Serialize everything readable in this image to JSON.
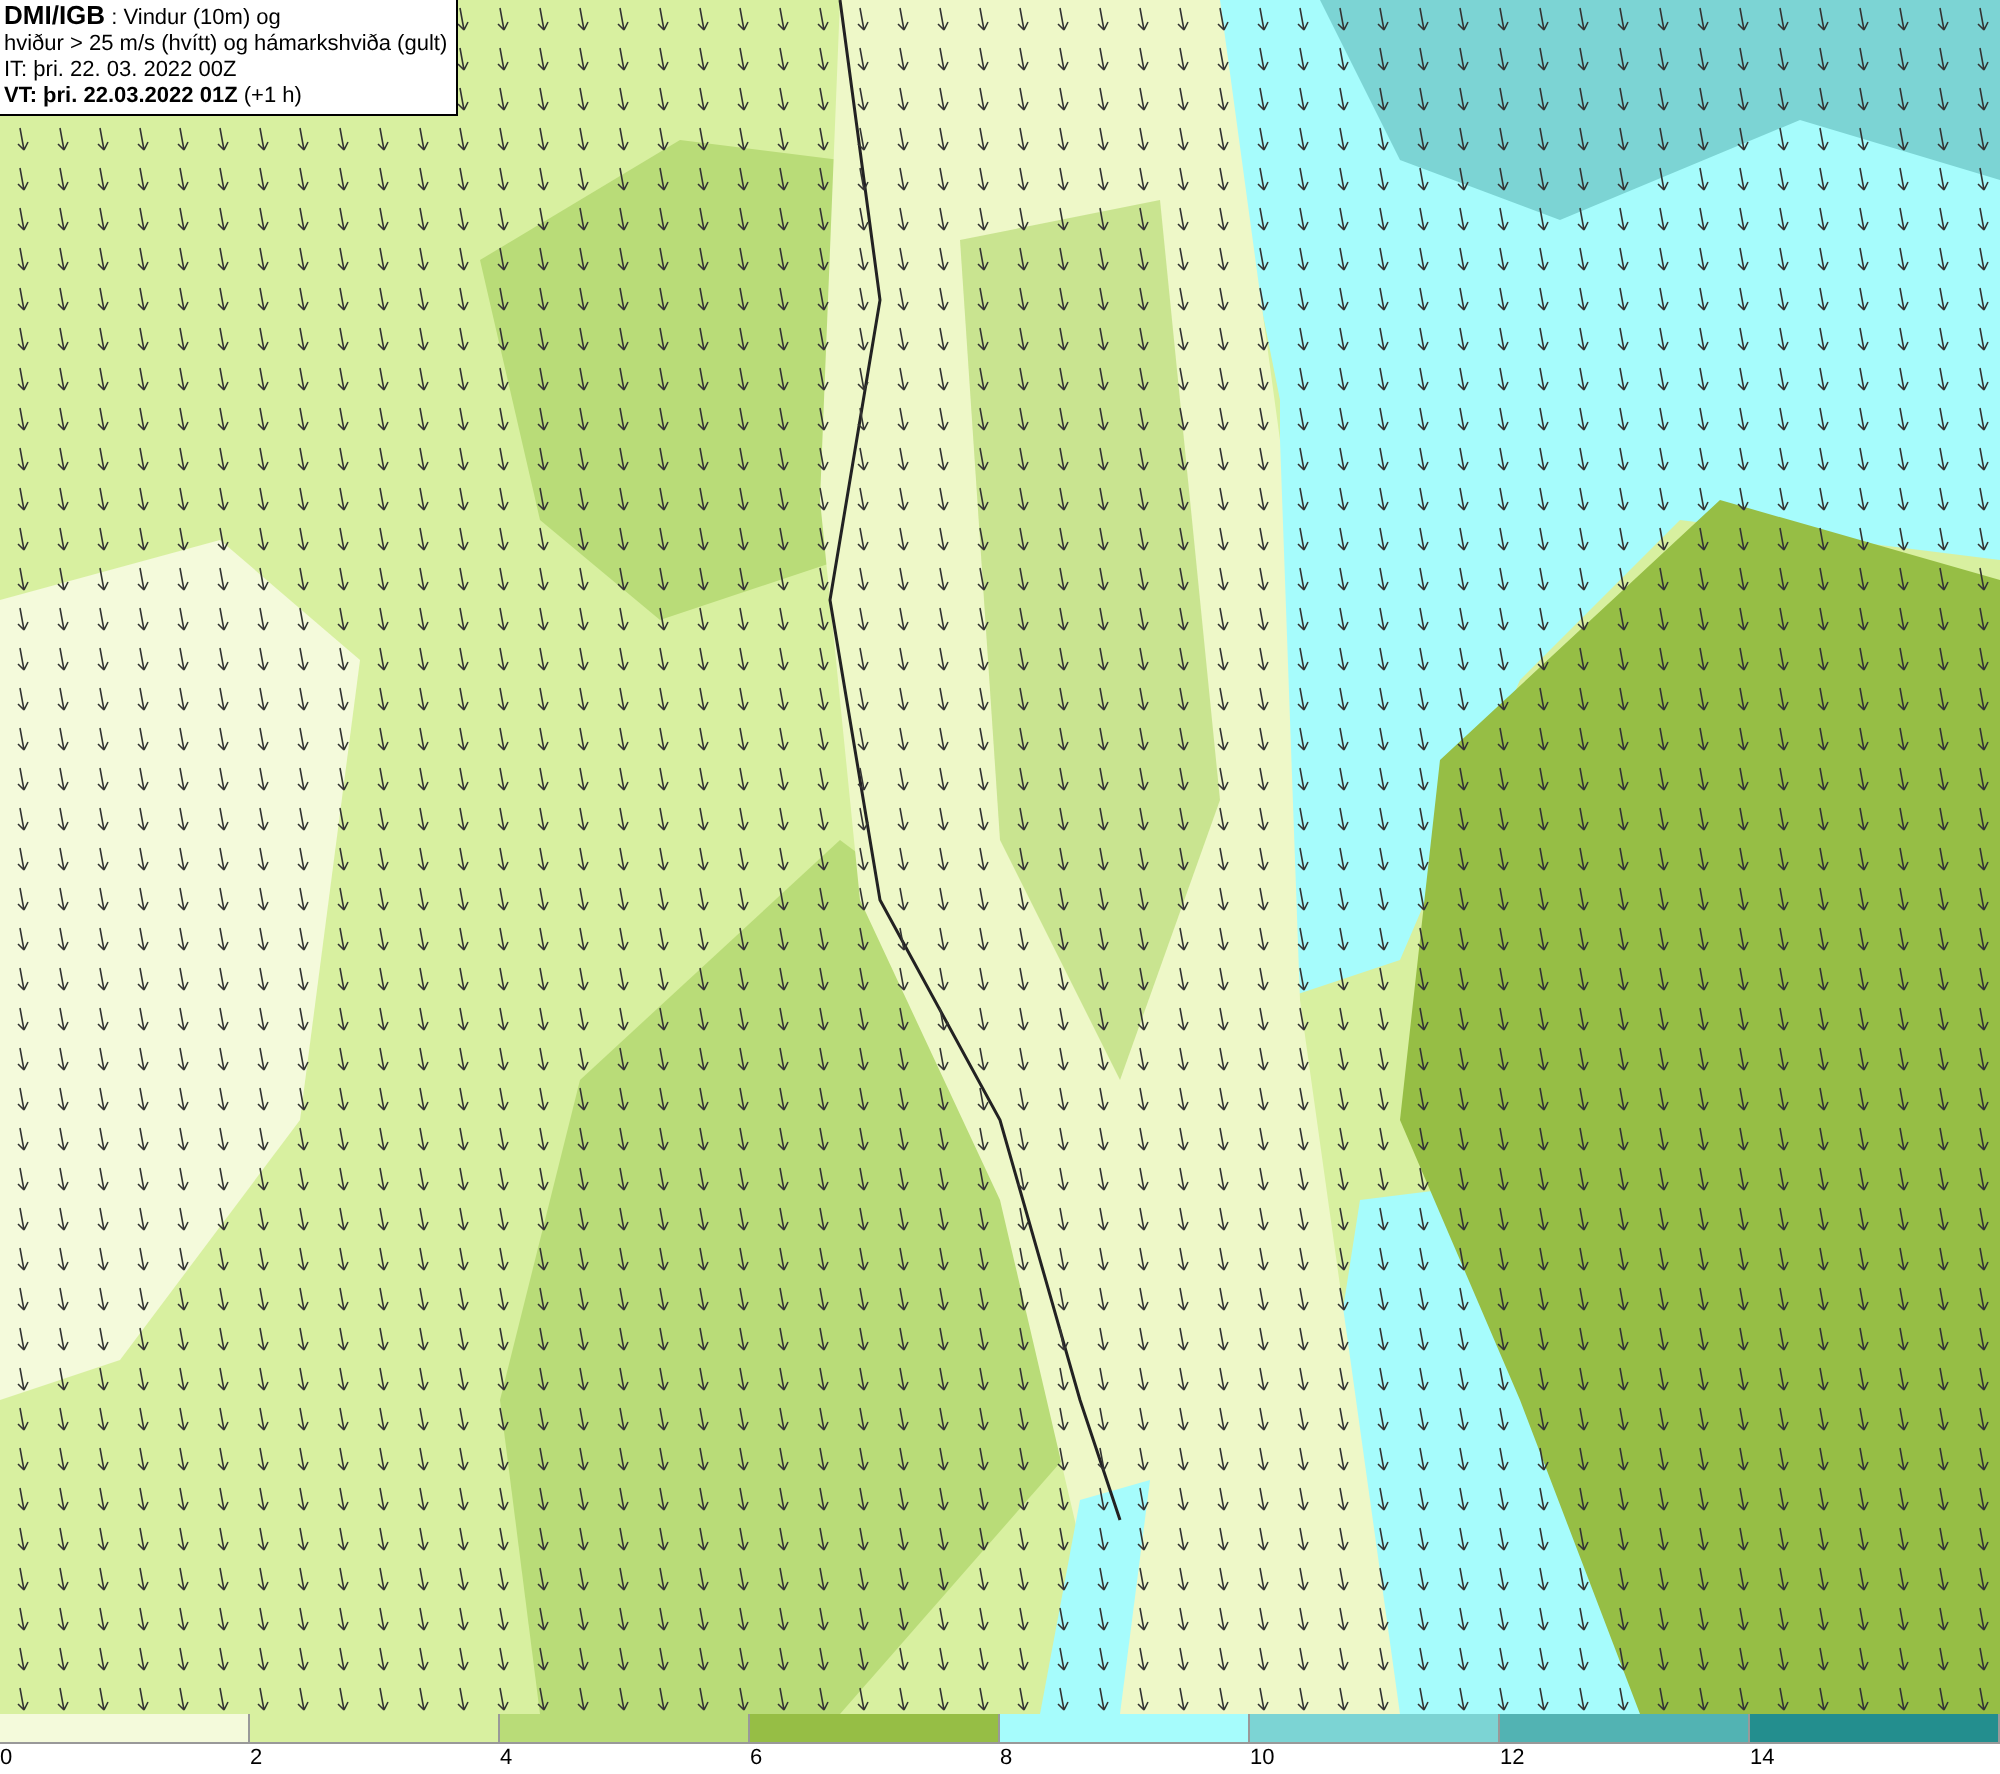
{
  "title_box": {
    "lines": [
      "**DMI/IGB** : Vindur (10m) og",
      "hviður > 25 m/s (hvítt) og hámarkshviða (gult)",
      "IT: þri. 22. 03. 2022 00Z",
      "**VT: þri. 22.03.2022 01Z** (+1 h)"
    ]
  },
  "legend": {
    "bins": [
      {
        "label": "0",
        "color": "#f4fadb"
      },
      {
        "label": "2",
        "color": "#d8f0a0"
      },
      {
        "label": "4",
        "color": "#b9dc78"
      },
      {
        "label": "6",
        "color": "#96be45"
      },
      {
        "label": "8",
        "color": "#a6fcfc"
      },
      {
        "label": "10",
        "color": "#7cd4d4"
      },
      {
        "label": "12",
        "color": "#52b3b3"
      },
      {
        "label": "14",
        "color": "#238e8e"
      }
    ]
  }
}
